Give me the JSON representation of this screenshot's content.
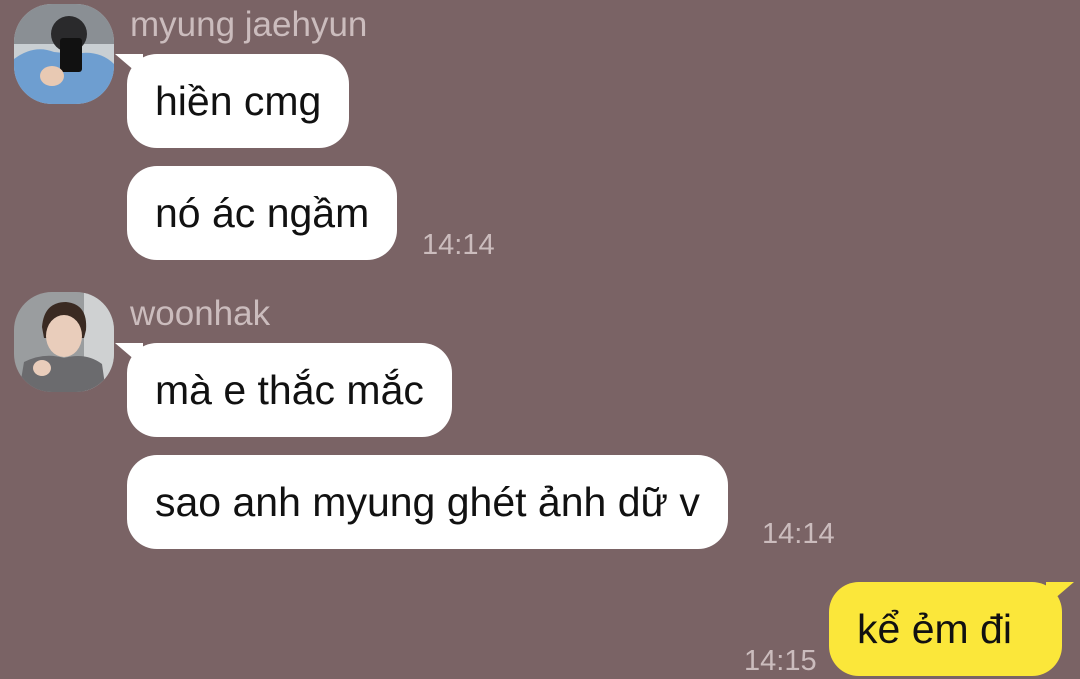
{
  "colors": {
    "background": "#7a6365",
    "incoming_bubble": "#ffffff",
    "outgoing_bubble": "#fbe73a",
    "meta_text": "#cbbcbd"
  },
  "groups": [
    {
      "sender": "myung jaehyun",
      "avatar_icon": "profile-photo-icon",
      "messages": [
        {
          "text": "hiền cmg"
        },
        {
          "text": "nó ác ngầm",
          "time": "14:14"
        }
      ]
    },
    {
      "sender": "woonhak",
      "avatar_icon": "profile-photo-icon",
      "messages": [
        {
          "text": "mà e thắc mắc"
        },
        {
          "text": "sao anh myung ghét ảnh dữ v",
          "time": "14:14"
        }
      ]
    }
  ],
  "outgoing": [
    {
      "text": "kể ẻm đi",
      "time": "14:15"
    }
  ]
}
